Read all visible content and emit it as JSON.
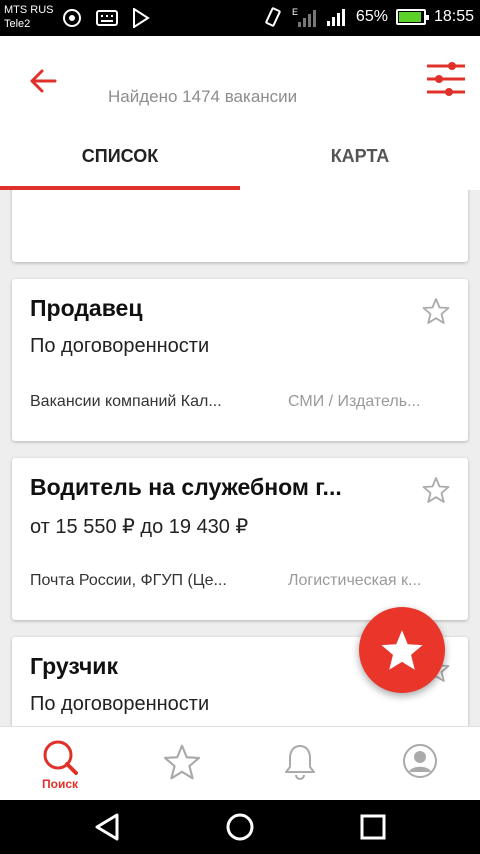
{
  "status_bar": {
    "carrier_1": "MTS RUS",
    "carrier_2": "Tele2",
    "network_label": "E",
    "battery": "65%",
    "time": "18:55"
  },
  "header": {
    "found_text": "Найдено 1474 вакансии",
    "tabs": [
      {
        "label": "СПИСОК",
        "active": true
      },
      {
        "label": "КАРТА",
        "active": false
      }
    ]
  },
  "jobs": [
    {
      "title": "Продавец",
      "salary": "По договоренности",
      "company": "Вакансии компаний Кал...",
      "category": "СМИ / Издатель..."
    },
    {
      "title": "Водитель на служебном г...",
      "salary": "от 15 550 ₽ до 19 430 ₽",
      "company": "Почта России, ФГУП (Це...",
      "category": "Логистическая к..."
    },
    {
      "title": "Грузчик",
      "salary": "По договоренности",
      "company": "",
      "category": ""
    }
  ],
  "bottom_nav": {
    "items": [
      {
        "label": "Поиск",
        "icon": "search-icon",
        "active": true
      },
      {
        "label": "",
        "icon": "star-icon",
        "active": false
      },
      {
        "label": "",
        "icon": "bell-icon",
        "active": false
      },
      {
        "label": "",
        "icon": "profile-icon",
        "active": false
      }
    ]
  },
  "colors": {
    "accent": "#e0302a",
    "fab": "#e9352a",
    "battery": "#5bd12a"
  }
}
